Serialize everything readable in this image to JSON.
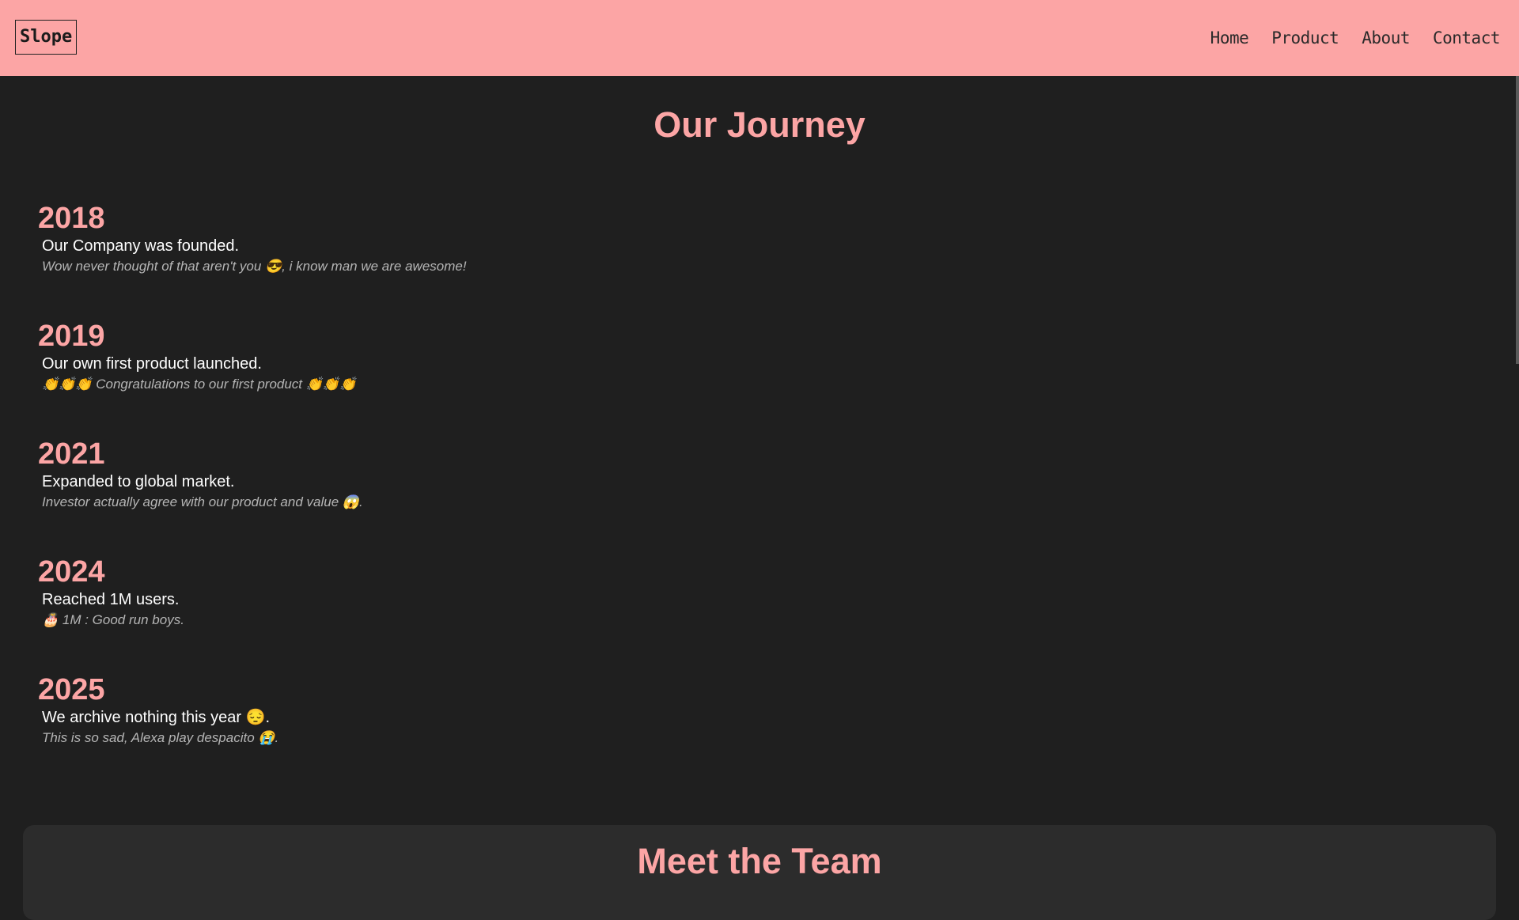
{
  "navbar": {
    "logo": "Slope",
    "links": [
      "Home",
      "Product",
      "About",
      "Contact"
    ]
  },
  "journey": {
    "title": "Our Journey",
    "items": [
      {
        "year": "2018",
        "event": "Our Company was founded.",
        "note": "Wow never thought of that aren't you 😎, i know man we are awesome!"
      },
      {
        "year": "2019",
        "event": "Our own first product launched.",
        "note": "👏👏👏 Congratulations to our first product 👏👏👏"
      },
      {
        "year": "2021",
        "event": "Expanded to global market.",
        "note": "Investor actually agree with our product and value 😱."
      },
      {
        "year": "2024",
        "event": "Reached 1M users.",
        "note": "🎂 1M : Good run boys."
      },
      {
        "year": "2025",
        "event": "We archive nothing this year 😔.",
        "note": "This is so sad, Alexa play despacito 😭."
      }
    ]
  },
  "team": {
    "title": "Meet the Team"
  }
}
